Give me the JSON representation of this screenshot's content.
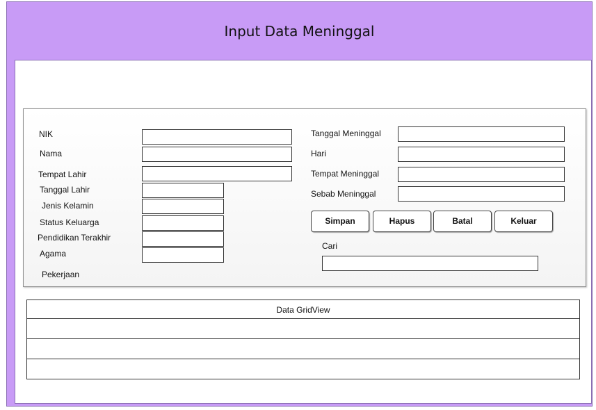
{
  "window": {
    "title": "Input Data Meninggal"
  },
  "left_fields": [
    {
      "label": "NIK",
      "value": ""
    },
    {
      "label": "Nama",
      "value": ""
    },
    {
      "label": "Tempat Lahir",
      "value": ""
    },
    {
      "label": "Tanggal Lahir",
      "value": ""
    },
    {
      "label": "Jenis Kelamin",
      "value": ""
    },
    {
      "label": "Status Keluarga",
      "value": ""
    },
    {
      "label": "Pendidikan Terakhir",
      "value": ""
    },
    {
      "label": "Agama",
      "value": ""
    },
    {
      "label": "Pekerjaan",
      "value": ""
    }
  ],
  "right_fields": [
    {
      "label": "Tanggal Meninggal",
      "value": ""
    },
    {
      "label": "Hari",
      "value": ""
    },
    {
      "label": "Tempat Meninggal",
      "value": ""
    },
    {
      "label": "Sebab Meninggal",
      "value": ""
    }
  ],
  "buttons": {
    "simpan": "Simpan",
    "hapus": "Hapus",
    "batal": "Batal",
    "keluar": "Keluar"
  },
  "search": {
    "label": "Cari",
    "value": ""
  },
  "grid": {
    "header": "Data GridView",
    "rows": [
      {},
      {},
      {}
    ]
  }
}
